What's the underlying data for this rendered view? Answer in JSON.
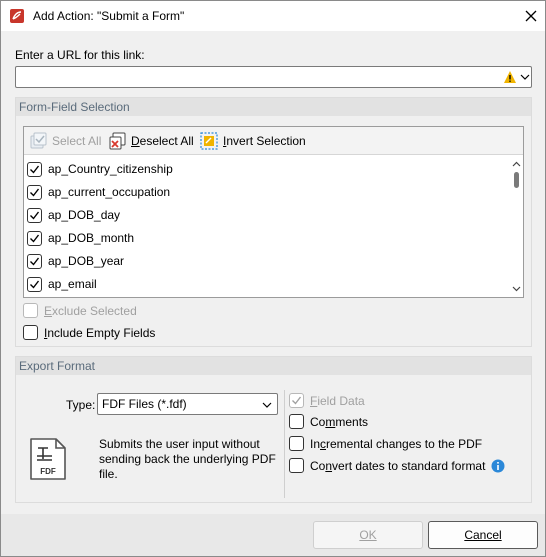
{
  "window": {
    "title": "Add Action: \"Submit a Form\""
  },
  "url": {
    "label": "Enter a URL for this link:",
    "value": ""
  },
  "form_field_selection": {
    "header": "Form-Field Selection",
    "toolbar": {
      "select_all": "Select All",
      "deselect_all": "Deselect All",
      "invert_selection": "Invert Selection"
    },
    "fields": [
      {
        "label": "ap_Country_citizenship",
        "checked": true
      },
      {
        "label": "ap_current_occupation",
        "checked": true
      },
      {
        "label": "ap_DOB_day",
        "checked": true
      },
      {
        "label": "ap_DOB_month",
        "checked": true
      },
      {
        "label": "ap_DOB_year",
        "checked": true
      },
      {
        "label": "ap_email",
        "checked": true
      }
    ],
    "exclude_selected": "Exclude Selected",
    "include_empty_fields": "Include Empty Fields"
  },
  "export_format": {
    "header": "Export Format",
    "type_label": "Type:",
    "type_value": "FDF Files (*.fdf)",
    "description": "Submits the user input without sending back the underlying PDF file.",
    "icon_label": "FDF",
    "options": {
      "field_data": "Field Data",
      "comments": "Comments",
      "incremental_changes": "Incremental changes to the PDF",
      "convert_dates": "Convert dates to standard format"
    }
  },
  "buttons": {
    "ok": "OK",
    "cancel": "Cancel"
  },
  "colors": {
    "accent": "#005fb8",
    "warning": "#f0b400",
    "info": "#2b88d8",
    "app_icon": "#c8362b"
  }
}
